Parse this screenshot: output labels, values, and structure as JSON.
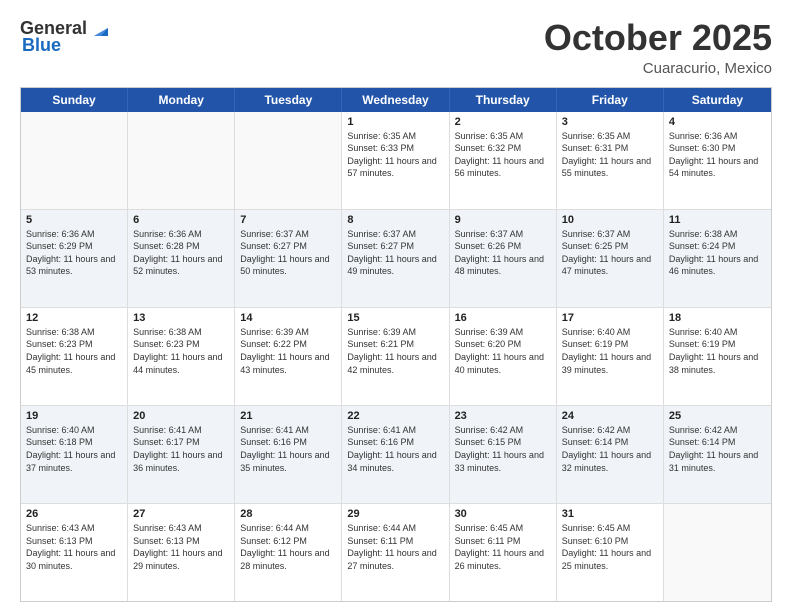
{
  "header": {
    "logo_general": "General",
    "logo_blue": "Blue",
    "month_title": "October 2025",
    "location": "Cuaracurio, Mexico"
  },
  "calendar": {
    "days_of_week": [
      "Sunday",
      "Monday",
      "Tuesday",
      "Wednesday",
      "Thursday",
      "Friday",
      "Saturday"
    ],
    "weeks": [
      [
        {
          "day": "",
          "sunrise": "",
          "sunset": "",
          "daylight": ""
        },
        {
          "day": "",
          "sunrise": "",
          "sunset": "",
          "daylight": ""
        },
        {
          "day": "",
          "sunrise": "",
          "sunset": "",
          "daylight": ""
        },
        {
          "day": "1",
          "sunrise": "Sunrise: 6:35 AM",
          "sunset": "Sunset: 6:33 PM",
          "daylight": "Daylight: 11 hours and 57 minutes."
        },
        {
          "day": "2",
          "sunrise": "Sunrise: 6:35 AM",
          "sunset": "Sunset: 6:32 PM",
          "daylight": "Daylight: 11 hours and 56 minutes."
        },
        {
          "day": "3",
          "sunrise": "Sunrise: 6:35 AM",
          "sunset": "Sunset: 6:31 PM",
          "daylight": "Daylight: 11 hours and 55 minutes."
        },
        {
          "day": "4",
          "sunrise": "Sunrise: 6:36 AM",
          "sunset": "Sunset: 6:30 PM",
          "daylight": "Daylight: 11 hours and 54 minutes."
        }
      ],
      [
        {
          "day": "5",
          "sunrise": "Sunrise: 6:36 AM",
          "sunset": "Sunset: 6:29 PM",
          "daylight": "Daylight: 11 hours and 53 minutes."
        },
        {
          "day": "6",
          "sunrise": "Sunrise: 6:36 AM",
          "sunset": "Sunset: 6:28 PM",
          "daylight": "Daylight: 11 hours and 52 minutes."
        },
        {
          "day": "7",
          "sunrise": "Sunrise: 6:37 AM",
          "sunset": "Sunset: 6:27 PM",
          "daylight": "Daylight: 11 hours and 50 minutes."
        },
        {
          "day": "8",
          "sunrise": "Sunrise: 6:37 AM",
          "sunset": "Sunset: 6:27 PM",
          "daylight": "Daylight: 11 hours and 49 minutes."
        },
        {
          "day": "9",
          "sunrise": "Sunrise: 6:37 AM",
          "sunset": "Sunset: 6:26 PM",
          "daylight": "Daylight: 11 hours and 48 minutes."
        },
        {
          "day": "10",
          "sunrise": "Sunrise: 6:37 AM",
          "sunset": "Sunset: 6:25 PM",
          "daylight": "Daylight: 11 hours and 47 minutes."
        },
        {
          "day": "11",
          "sunrise": "Sunrise: 6:38 AM",
          "sunset": "Sunset: 6:24 PM",
          "daylight": "Daylight: 11 hours and 46 minutes."
        }
      ],
      [
        {
          "day": "12",
          "sunrise": "Sunrise: 6:38 AM",
          "sunset": "Sunset: 6:23 PM",
          "daylight": "Daylight: 11 hours and 45 minutes."
        },
        {
          "day": "13",
          "sunrise": "Sunrise: 6:38 AM",
          "sunset": "Sunset: 6:23 PM",
          "daylight": "Daylight: 11 hours and 44 minutes."
        },
        {
          "day": "14",
          "sunrise": "Sunrise: 6:39 AM",
          "sunset": "Sunset: 6:22 PM",
          "daylight": "Daylight: 11 hours and 43 minutes."
        },
        {
          "day": "15",
          "sunrise": "Sunrise: 6:39 AM",
          "sunset": "Sunset: 6:21 PM",
          "daylight": "Daylight: 11 hours and 42 minutes."
        },
        {
          "day": "16",
          "sunrise": "Sunrise: 6:39 AM",
          "sunset": "Sunset: 6:20 PM",
          "daylight": "Daylight: 11 hours and 40 minutes."
        },
        {
          "day": "17",
          "sunrise": "Sunrise: 6:40 AM",
          "sunset": "Sunset: 6:19 PM",
          "daylight": "Daylight: 11 hours and 39 minutes."
        },
        {
          "day": "18",
          "sunrise": "Sunrise: 6:40 AM",
          "sunset": "Sunset: 6:19 PM",
          "daylight": "Daylight: 11 hours and 38 minutes."
        }
      ],
      [
        {
          "day": "19",
          "sunrise": "Sunrise: 6:40 AM",
          "sunset": "Sunset: 6:18 PM",
          "daylight": "Daylight: 11 hours and 37 minutes."
        },
        {
          "day": "20",
          "sunrise": "Sunrise: 6:41 AM",
          "sunset": "Sunset: 6:17 PM",
          "daylight": "Daylight: 11 hours and 36 minutes."
        },
        {
          "day": "21",
          "sunrise": "Sunrise: 6:41 AM",
          "sunset": "Sunset: 6:16 PM",
          "daylight": "Daylight: 11 hours and 35 minutes."
        },
        {
          "day": "22",
          "sunrise": "Sunrise: 6:41 AM",
          "sunset": "Sunset: 6:16 PM",
          "daylight": "Daylight: 11 hours and 34 minutes."
        },
        {
          "day": "23",
          "sunrise": "Sunrise: 6:42 AM",
          "sunset": "Sunset: 6:15 PM",
          "daylight": "Daylight: 11 hours and 33 minutes."
        },
        {
          "day": "24",
          "sunrise": "Sunrise: 6:42 AM",
          "sunset": "Sunset: 6:14 PM",
          "daylight": "Daylight: 11 hours and 32 minutes."
        },
        {
          "day": "25",
          "sunrise": "Sunrise: 6:42 AM",
          "sunset": "Sunset: 6:14 PM",
          "daylight": "Daylight: 11 hours and 31 minutes."
        }
      ],
      [
        {
          "day": "26",
          "sunrise": "Sunrise: 6:43 AM",
          "sunset": "Sunset: 6:13 PM",
          "daylight": "Daylight: 11 hours and 30 minutes."
        },
        {
          "day": "27",
          "sunrise": "Sunrise: 6:43 AM",
          "sunset": "Sunset: 6:13 PM",
          "daylight": "Daylight: 11 hours and 29 minutes."
        },
        {
          "day": "28",
          "sunrise": "Sunrise: 6:44 AM",
          "sunset": "Sunset: 6:12 PM",
          "daylight": "Daylight: 11 hours and 28 minutes."
        },
        {
          "day": "29",
          "sunrise": "Sunrise: 6:44 AM",
          "sunset": "Sunset: 6:11 PM",
          "daylight": "Daylight: 11 hours and 27 minutes."
        },
        {
          "day": "30",
          "sunrise": "Sunrise: 6:45 AM",
          "sunset": "Sunset: 6:11 PM",
          "daylight": "Daylight: 11 hours and 26 minutes."
        },
        {
          "day": "31",
          "sunrise": "Sunrise: 6:45 AM",
          "sunset": "Sunset: 6:10 PM",
          "daylight": "Daylight: 11 hours and 25 minutes."
        },
        {
          "day": "",
          "sunrise": "",
          "sunset": "",
          "daylight": ""
        }
      ]
    ]
  }
}
